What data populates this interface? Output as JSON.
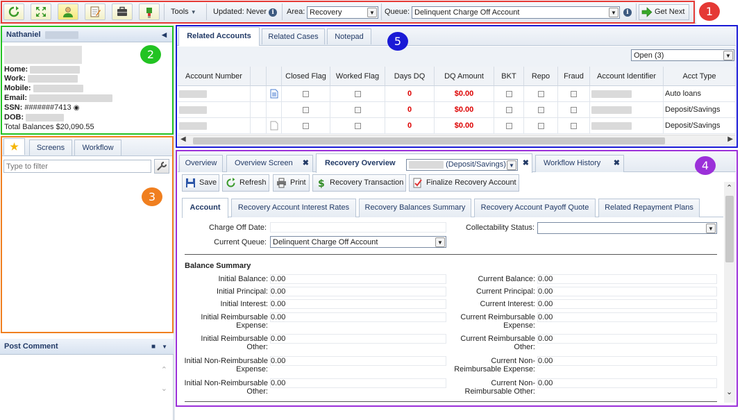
{
  "toolbar": {
    "icons": [
      "refresh-icon",
      "expand-icon",
      "contact-icon",
      "notes-icon",
      "briefcase-icon",
      "plugin-icon"
    ],
    "tools_label": "Tools",
    "updated_label": "Updated: Never",
    "area_label": "Area:",
    "area_value": "Recovery",
    "queue_label": "Queue:",
    "queue_value": "Delinquent Charge Off Account",
    "get_next_label": "Get Next"
  },
  "badges": {
    "b1": "1",
    "b2": "2",
    "b3": "3",
    "b4": "4",
    "b5": "5"
  },
  "contact": {
    "name": "Nathaniel",
    "home_label": "Home:",
    "work_label": "Work:",
    "mobile_label": "Mobile:",
    "email_label": "Email:",
    "ssn_label": "SSN:",
    "ssn_value": "#######7413",
    "dob_label": "DOB:",
    "total_balances": "Total Balances $20,090.55"
  },
  "screens_panel": {
    "tabs": [
      "Screens",
      "Workflow"
    ],
    "filter_placeholder": "Type to filter"
  },
  "post_comment": {
    "title": "Post Comment"
  },
  "related": {
    "tabs": [
      "Related Accounts",
      "Related Cases",
      "Notepad"
    ],
    "filter_value": "Open (3)",
    "columns": [
      "Account Number",
      "",
      "",
      "Closed Flag",
      "Worked Flag",
      "Days DQ",
      "DQ Amount",
      "BKT",
      "Repo",
      "Fraud",
      "Account Identifier",
      "Acct Type"
    ],
    "rows": [
      {
        "days_dq": "0",
        "dq_amount": "$0.00",
        "acct_type": "Auto loans"
      },
      {
        "days_dq": "0",
        "dq_amount": "$0.00",
        "acct_type": "Deposit/Savings"
      },
      {
        "days_dq": "0",
        "dq_amount": "$0.00",
        "acct_type": "Deposit/Savings"
      }
    ]
  },
  "overview": {
    "tabs": [
      "Overview",
      "Overview Screen",
      "Recovery Overview",
      "Workflow History"
    ],
    "account_select": "(Deposit/Savings)",
    "buttons": [
      "Save",
      "Refresh",
      "Print",
      "Recovery Transaction",
      "Finalize Recovery Account"
    ],
    "subtabs": [
      "Account",
      "Recovery Account Interest Rates",
      "Recovery Balances Summary",
      "Recovery Account Payoff Quote",
      "Related Repayment Plans"
    ],
    "charge_off_date_label": "Charge Off Date:",
    "collectability_label": "Collectability Status:",
    "current_queue_label": "Current Queue:",
    "current_queue_value": "Delinquent Charge Off Account",
    "balance_summary_title": "Balance Summary",
    "left_fields": [
      {
        "label": "Initial Balance:",
        "value": "0.00"
      },
      {
        "label": "Initial Principal:",
        "value": "0.00"
      },
      {
        "label": "Initial Interest:",
        "value": "0.00"
      },
      {
        "label": "Initial Reimbursable Expense:",
        "value": "0.00"
      },
      {
        "label": "Initial Reimbursable Other:",
        "value": "0.00"
      },
      {
        "label": "Initial Non-Reimbursable Expense:",
        "value": "0.00"
      },
      {
        "label": "Initial Non-Reimbursable Other:",
        "value": "0.00"
      }
    ],
    "right_fields": [
      {
        "label": "Current Balance:",
        "value": "0.00"
      },
      {
        "label": "Current Principal:",
        "value": "0.00"
      },
      {
        "label": "Current Interest:",
        "value": "0.00"
      },
      {
        "label": "Current Reimbursable Expense:",
        "value": "0.00"
      },
      {
        "label": "Current Reimbursable Other:",
        "value": "0.00"
      },
      {
        "label": "Current Non-Reimbursable Expense:",
        "value": "0.00"
      },
      {
        "label": "Current Non-Reimbursable Other:",
        "value": "0.00"
      }
    ]
  },
  "colors": {
    "red_outline": "#e53935",
    "green_outline": "#22c322",
    "orange_outline": "#f07f1f",
    "blue_outline": "#1a1ad6",
    "purple_outline": "#9b30d9"
  }
}
